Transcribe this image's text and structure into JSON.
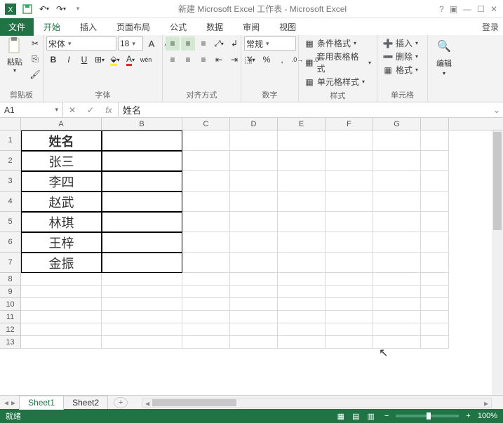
{
  "title": "新建 Microsoft Excel 工作表 - Microsoft Excel",
  "qat_icons": [
    "excel",
    "save",
    "undo",
    "redo"
  ],
  "login_label": "登录",
  "menus": {
    "file": "文件",
    "tabs": [
      "开始",
      "插入",
      "页面布局",
      "公式",
      "数据",
      "审阅",
      "视图"
    ],
    "active": "开始"
  },
  "ribbon": {
    "clipboard": {
      "label": "剪贴板",
      "paste": "粘贴"
    },
    "font": {
      "label": "字体",
      "name": "宋体",
      "size": "18",
      "buttons": {
        "bold": "B",
        "italic": "I",
        "underline": "U",
        "border": "⊞",
        "fill": "▣",
        "color": "A",
        "grow": "A",
        "shrink": "A",
        "phonetic": "wén"
      }
    },
    "align": {
      "label": "对齐方式"
    },
    "number": {
      "label": "数字",
      "format": "常规"
    },
    "styles": {
      "label": "样式",
      "cond_format": "条件格式",
      "table_format": "套用表格格式",
      "cell_styles": "单元格样式"
    },
    "cells": {
      "label": "单元格",
      "insert": "插入",
      "delete": "删除",
      "format": "格式"
    },
    "editing": {
      "label": "编辑"
    }
  },
  "namebox": "A1",
  "formula": "姓名",
  "columns": [
    "A",
    "B",
    "C",
    "D",
    "E",
    "F",
    "G"
  ],
  "row_count": 13,
  "data_rows": [
    {
      "r": 1,
      "A": "姓名",
      "B": ""
    },
    {
      "r": 2,
      "A": "张三",
      "B": ""
    },
    {
      "r": 3,
      "A": "李四",
      "B": ""
    },
    {
      "r": 4,
      "A": "赵武",
      "B": ""
    },
    {
      "r": 5,
      "A": "林琪",
      "B": ""
    },
    {
      "r": 6,
      "A": "王梓",
      "B": ""
    },
    {
      "r": 7,
      "A": "金振",
      "B": ""
    }
  ],
  "sheets": {
    "tabs": [
      "Sheet1",
      "Sheet2"
    ],
    "active": "Sheet1"
  },
  "status": {
    "ready": "就绪",
    "zoom": "100%"
  },
  "chart_data": {
    "type": "table",
    "title": "姓名",
    "columns": [
      "姓名"
    ],
    "rows": [
      [
        "张三"
      ],
      [
        "李四"
      ],
      [
        "赵武"
      ],
      [
        "林琪"
      ],
      [
        "王梓"
      ],
      [
        "金振"
      ]
    ]
  }
}
